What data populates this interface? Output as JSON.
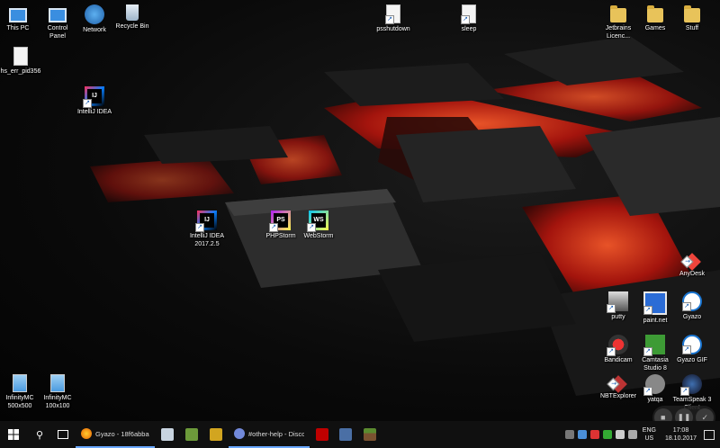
{
  "desktop": {
    "icons": {
      "this_pc": "This PC",
      "control_panel": "Control\nPanel",
      "network": "Network",
      "recycle_bin": "Recycle Bin",
      "psshutdown": "psshutdown",
      "sleep": "sleep",
      "jetbrains": "Jetbrains\nLicenc...",
      "games": "Games",
      "stuff": "Stuff",
      "hs_err": "hs_err_pid356",
      "intellij": "IntelliJ IDEA",
      "intellij_2017": "IntelliJ IDEA\n2017.2.5",
      "phpstorm": "PHPStorm",
      "webstorm": "WebStorm",
      "anydesk": "AnyDesk",
      "putty": "putty",
      "paintnet": "paint.net",
      "gyazo": "Gyazo",
      "bandicam": "Bandicam",
      "camtasia": "Camtasia\nStudio 8",
      "gyazo_gif": "Gyazo GIF",
      "nbtexplorer": "NBTExplorer",
      "yatqa": "yatqa",
      "teamspeak": "TeamSpeak 3\nClient",
      "infinity_500": "InfinityMC\n500x500",
      "infinity_100": "InfinityMC\n100x100"
    }
  },
  "taskbar": {
    "task_gyazo": "Gyazo - 18f6abba05...",
    "task_discord": "#other-help - Disco...",
    "lang_line1": "ENG",
    "lang_line2": "US",
    "time": "17:08",
    "date": "18.10.2017"
  },
  "colors": {
    "accent": "#6aa8ff",
    "lava": "#c41a10"
  }
}
